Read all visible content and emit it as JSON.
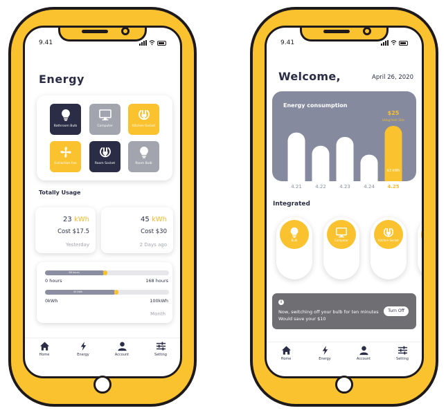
{
  "left": {
    "status_time": "9.41",
    "title": "Energy",
    "devices": [
      {
        "label": "Bathroom Bulb",
        "icon": "bulb-icon",
        "style": "dark"
      },
      {
        "label": "Computer",
        "icon": "monitor-icon",
        "style": "gray"
      },
      {
        "label": "Kitchen Socket",
        "icon": "socket-icon",
        "style": "yellow"
      },
      {
        "label": "Extraction Fan",
        "icon": "fan-icon",
        "style": "yellow"
      },
      {
        "label": "Room Socket",
        "icon": "socket-icon",
        "style": "dark"
      },
      {
        "label": "Room Bulb",
        "icon": "bulb-icon",
        "style": "gray"
      }
    ],
    "usage_title": "Totally Usage",
    "usage": [
      {
        "value": "23",
        "unit": "kWh",
        "cost": "Cost $17.5",
        "when": "Yesterday"
      },
      {
        "value": "45",
        "unit": "kWh",
        "cost": "Cost $30",
        "when": "2 Days ago"
      }
    ],
    "progress": [
      {
        "fraction": 0.48,
        "min": "0 hours",
        "max": "168 hours",
        "fill_label": "88 hours"
      },
      {
        "fraction": 0.57,
        "min": "0kWh",
        "max": "100kWh",
        "fill_label": "45 kWh"
      }
    ],
    "period": "Month"
  },
  "right": {
    "status_time": "9.41",
    "welcome": "Welcome,",
    "date": "April 26, 2020",
    "integrated_title": "Integrated",
    "integrated": [
      {
        "label": "Bulb",
        "icon": "bulb-icon"
      },
      {
        "label": "Computer",
        "icon": "monitor-icon"
      },
      {
        "label": "Kitchen Socket",
        "icon": "socket-icon"
      }
    ],
    "tip": {
      "line1": "Now, switching off your bulb for ten minutes",
      "line2": "Would save your $10",
      "button": "Turn Off"
    }
  },
  "nav": [
    {
      "label": "Home",
      "icon": "home-icon"
    },
    {
      "label": "Energy",
      "icon": "bolt-icon"
    },
    {
      "label": "Account",
      "icon": "user-icon"
    },
    {
      "label": "Setting",
      "icon": "sliders-icon"
    }
  ],
  "colors": {
    "accent": "#f9c22e",
    "dark": "#2a2d45",
    "gray": "#a3a5ae",
    "chart_bg": "#868a9e"
  },
  "chart_data": {
    "type": "bar",
    "title": "Energy consumption",
    "categories": [
      "4.21",
      "4.22",
      "4.23",
      "4.24",
      "4.25"
    ],
    "values": [
      22,
      16,
      20,
      12,
      25
    ],
    "highlight_index": 4,
    "highlight_value_label": "$25",
    "highlight_sub_label": "Using from 11hr",
    "highlight_bar_label": "$3 kWh",
    "ylim": [
      0,
      30
    ]
  }
}
